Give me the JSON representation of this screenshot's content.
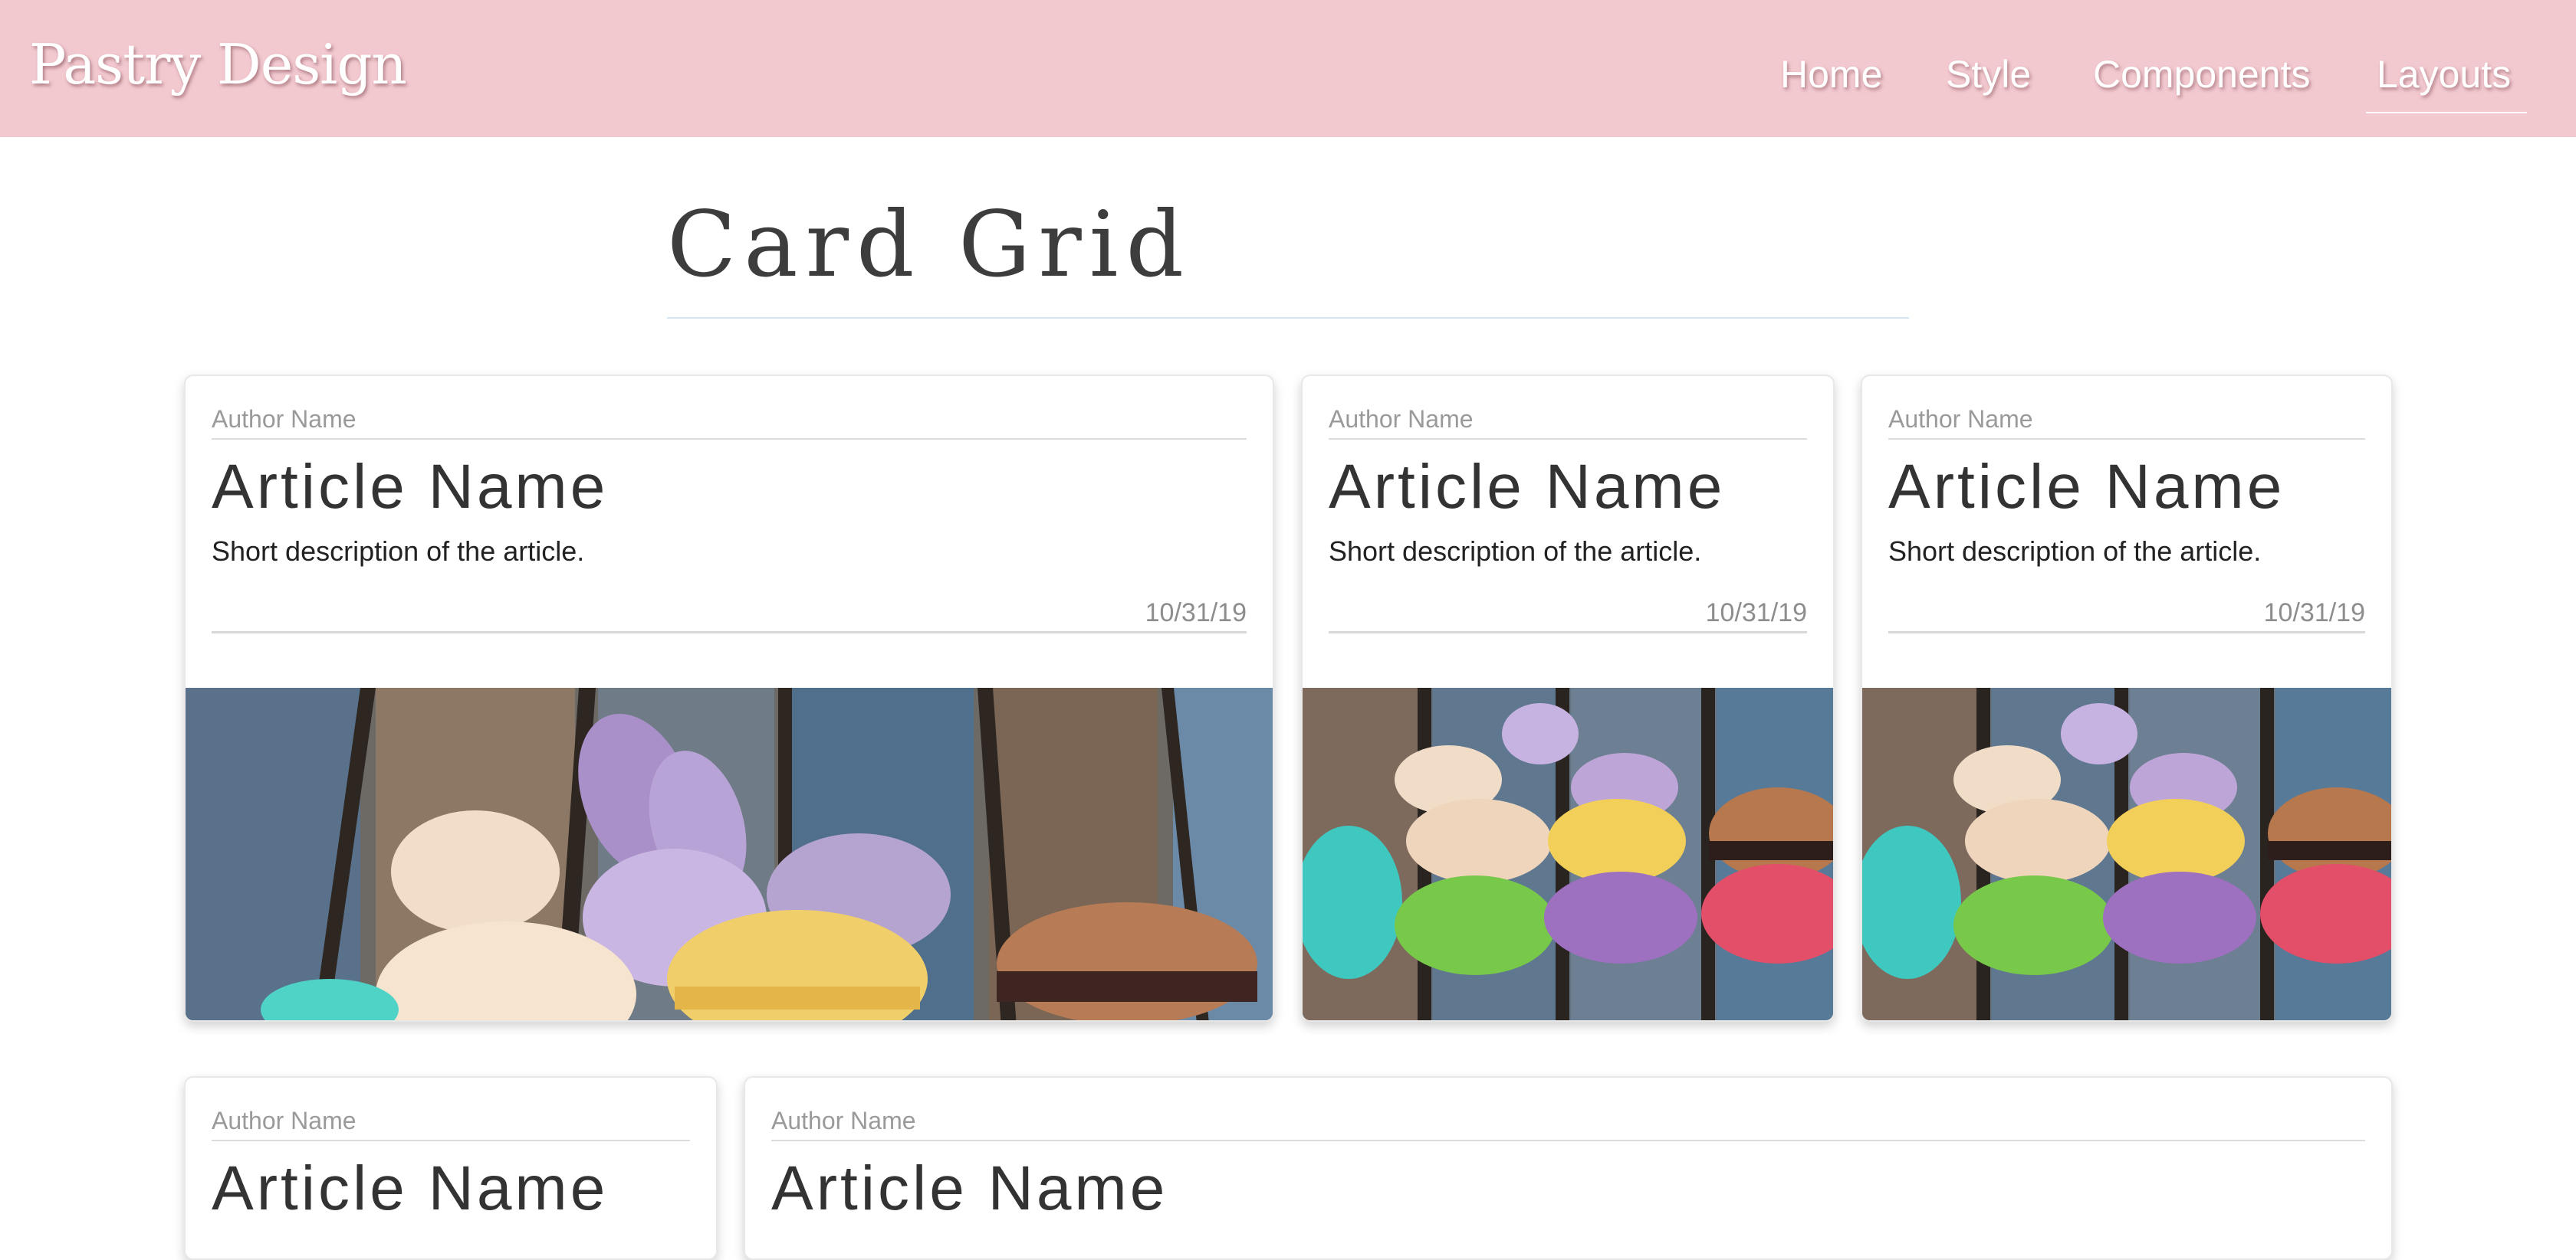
{
  "header": {
    "brand": "Pastry Design",
    "nav": [
      {
        "label": "Home"
      },
      {
        "label": "Style"
      },
      {
        "label": "Components"
      },
      {
        "label": "Layouts",
        "active": true
      }
    ]
  },
  "page": {
    "title": "Card Grid"
  },
  "cards": [
    {
      "author": "Author Name",
      "title": "Article Name",
      "description": "Short description of the article.",
      "date": "10/31/19",
      "image": "macarons-photo"
    },
    {
      "author": "Author Name",
      "title": "Article Name",
      "description": "Short description of the article.",
      "date": "10/31/19",
      "image": "macarons-photo"
    },
    {
      "author": "Author Name",
      "title": "Article Name",
      "description": "Short description of the article.",
      "date": "10/31/19",
      "image": "macarons-photo"
    },
    {
      "author": "Author Name",
      "title": "Article Name"
    },
    {
      "author": "Author Name",
      "title": "Article Name"
    }
  ],
  "colors": {
    "header_bg": "#f2c9cf",
    "title_text": "#3d3d3d",
    "muted_text": "#9a9a9a"
  }
}
